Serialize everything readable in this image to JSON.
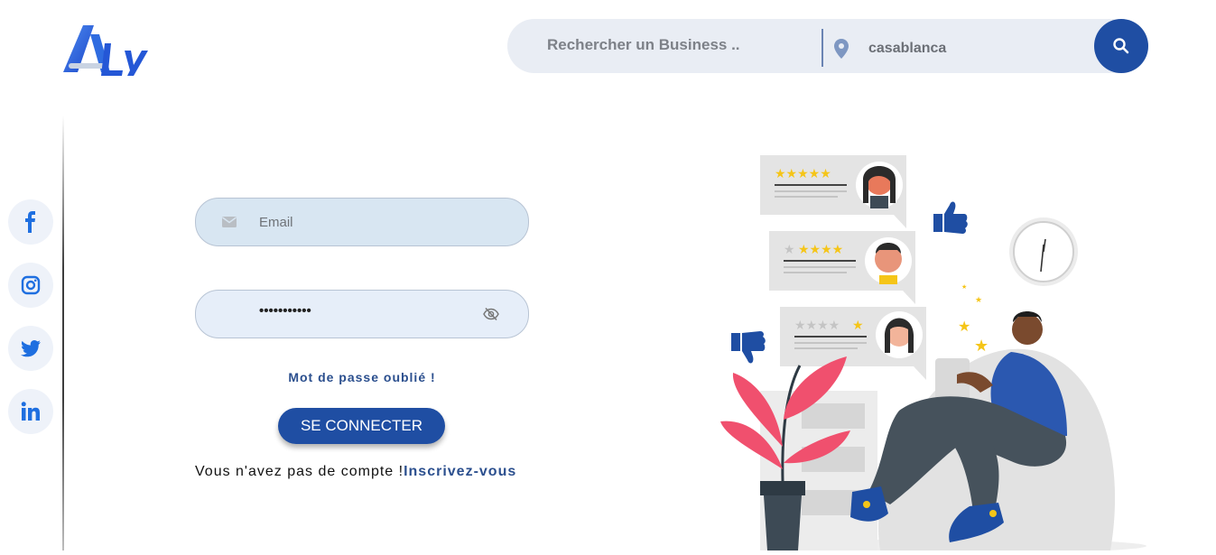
{
  "logo": {
    "text": "ALy"
  },
  "search": {
    "business_placeholder": "Rechercher un Business ..",
    "location_value": "casablanca",
    "button_icon": "search-icon"
  },
  "social": [
    {
      "name": "facebook",
      "icon": "facebook-icon"
    },
    {
      "name": "instagram",
      "icon": "instagram-icon"
    },
    {
      "name": "twitter",
      "icon": "twitter-icon"
    },
    {
      "name": "linkedin",
      "icon": "linkedin-icon"
    }
  ],
  "login": {
    "email_placeholder": "Email",
    "password_value": "•••••••••••",
    "forgot_password": "Mot de passe oublié !",
    "submit_label": "SE CONNECTER",
    "no_account_text": "Vous n'avez pas de compte !",
    "signup_link": "Inscrivez-vous"
  },
  "colors": {
    "primary": "#1f4ea3",
    "search_bg": "#e9edf4",
    "email_bg": "#d8e6f2",
    "password_bg": "#e6eef9",
    "star": "#f5c518",
    "plant": "#f0506e"
  }
}
